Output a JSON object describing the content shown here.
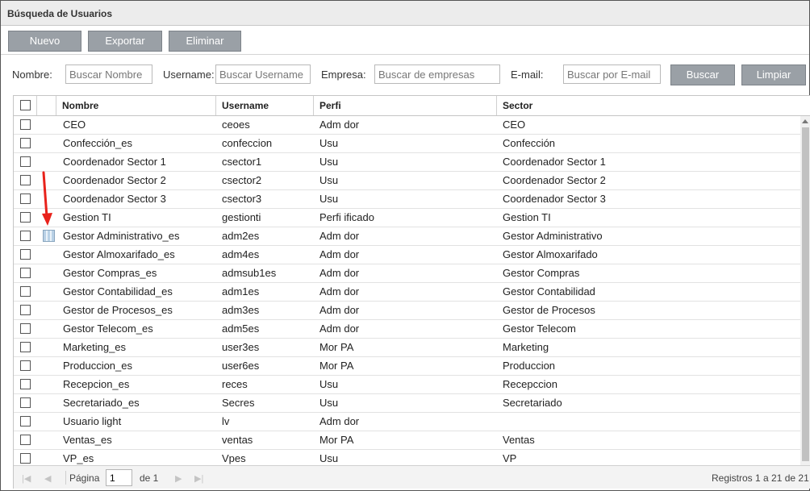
{
  "title": "Búsqueda de Usuarios",
  "toolbar": {
    "nuevo": "Nuevo",
    "exportar": "Exportar",
    "eliminar": "Eliminar"
  },
  "filters": {
    "nombre_label": "Nombre:",
    "nombre_placeholder": "Buscar Nombre",
    "username_label": "Username:",
    "username_placeholder": "Buscar Username",
    "empresa_label": "Empresa:",
    "empresa_placeholder": "Buscar de empresas",
    "email_label": "E-mail:",
    "email_placeholder": "Buscar por E-mail",
    "buscar": "Buscar",
    "limpiar": "Limpiar"
  },
  "columns": {
    "nombre": "Nombre",
    "username": "Username",
    "perfil": "Perfi",
    "sector": "Sector"
  },
  "rows": [
    {
      "nombre": "CEO",
      "username": "ceoes",
      "perfil": "Adm dor",
      "sector": "CEO"
    },
    {
      "nombre": "Confección_es",
      "username": "confeccion",
      "perfil": "Usu",
      "sector": "Confección"
    },
    {
      "nombre": "Coordenador Sector 1",
      "username": "csector1",
      "perfil": "Usu",
      "sector": "Coordenador Sector 1"
    },
    {
      "nombre": "Coordenador Sector 2",
      "username": "csector2",
      "perfil": "Usu",
      "sector": "Coordenador Sector 2"
    },
    {
      "nombre": "Coordenador Sector 3",
      "username": "csector3",
      "perfil": "Usu",
      "sector": "Coordenador Sector 3"
    },
    {
      "nombre": "Gestion TI",
      "username": "gestionti",
      "perfil": "Perfi ificado",
      "sector": "Gestion TI"
    },
    {
      "nombre": "Gestor Administrativo_es",
      "username": "adm2es",
      "perfil": "Adm dor",
      "sector": "Gestor Administrativo"
    },
    {
      "nombre": "Gestor Almoxarifado_es",
      "username": "adm4es",
      "perfil": "Adm dor",
      "sector": "Gestor Almoxarifado"
    },
    {
      "nombre": "Gestor Compras_es",
      "username": "admsub1es",
      "perfil": "Adm dor",
      "sector": "Gestor Compras"
    },
    {
      "nombre": "Gestor Contabilidad_es",
      "username": "adm1es",
      "perfil": "Adm dor",
      "sector": "Gestor Contabilidad"
    },
    {
      "nombre": "Gestor de Procesos_es",
      "username": "adm3es",
      "perfil": "Adm dor",
      "sector": "Gestor de Procesos"
    },
    {
      "nombre": "Gestor Telecom_es",
      "username": "adm5es",
      "perfil": "Adm dor",
      "sector": "Gestor Telecom"
    },
    {
      "nombre": "Marketing_es",
      "username": "user3es",
      "perfil": "Mor PA",
      "sector": "Marketing"
    },
    {
      "nombre": "Produccion_es",
      "username": "user6es",
      "perfil": "Mor PA",
      "sector": "Produccion"
    },
    {
      "nombre": "Recepcion_es",
      "username": "reces",
      "perfil": "Usu",
      "sector": "Recepccion"
    },
    {
      "nombre": "Secretariado_es",
      "username": "Secres",
      "perfil": "Usu",
      "sector": "Secretariado"
    },
    {
      "nombre": "Usuario light",
      "username": "lv",
      "perfil": "Adm dor",
      "sector": ""
    },
    {
      "nombre": "Ventas_es",
      "username": "ventas",
      "perfil": "Mor PA",
      "sector": "Ventas"
    },
    {
      "nombre": "VP_es",
      "username": "Vpes",
      "perfil": "Usu",
      "sector": "VP"
    }
  ],
  "pager": {
    "pagina_label": "Página",
    "page": "1",
    "of": "de 1",
    "registros": "Registros 1 a 21 de 21"
  },
  "annotation_color": "#e8221b",
  "row_icon": "grid-user-icon"
}
